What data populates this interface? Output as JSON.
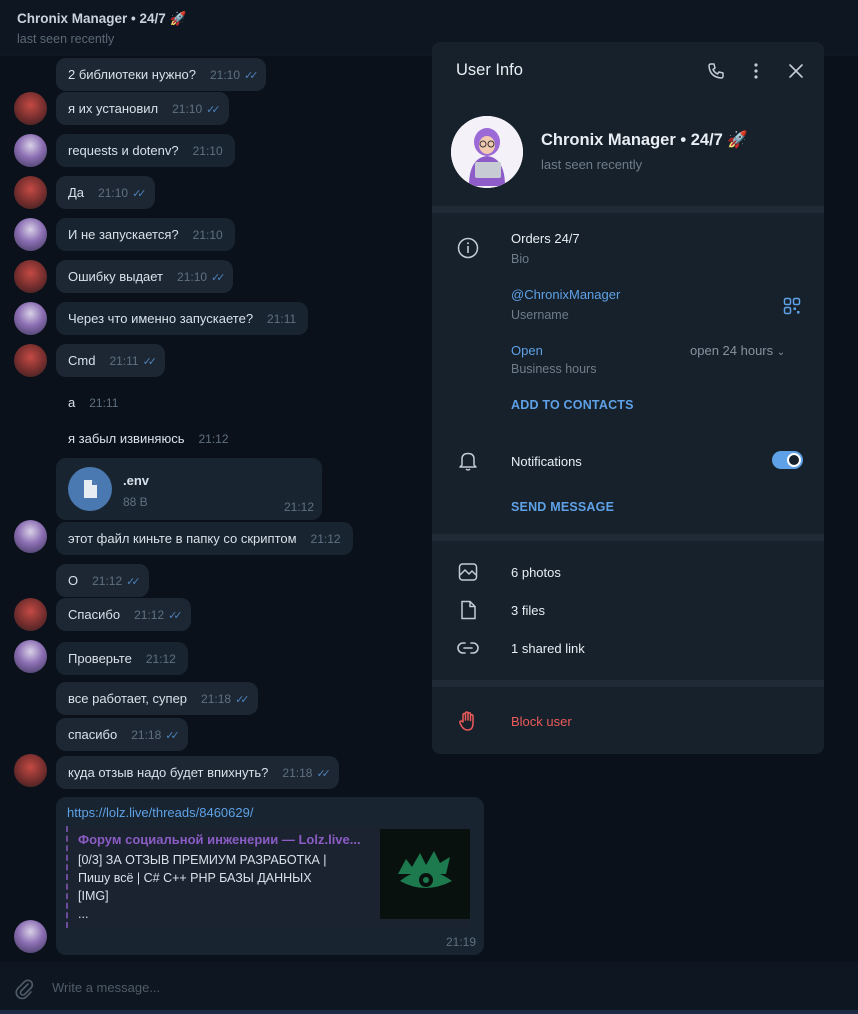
{
  "header": {
    "title": "Chronix Manager • 24/7 🚀",
    "status": "last seen recently"
  },
  "messages": [
    {
      "text": "2 библиотеки нужно?",
      "time": "21:10",
      "checks": true
    },
    {
      "text": "я их установил",
      "time": "21:10",
      "checks": true
    },
    {
      "text": "requests и dotenv?",
      "time": "21:10",
      "checks": false
    },
    {
      "text": "Да",
      "time": "21:10",
      "checks": true
    },
    {
      "text": "И не запускается?",
      "time": "21:10",
      "checks": false
    },
    {
      "text": "Ошибку выдает",
      "time": "21:10",
      "checks": true
    },
    {
      "text": "Через что именно запускаете?",
      "time": "21:11",
      "checks": false
    },
    {
      "text": "Cmd",
      "time": "21:11",
      "checks": true
    },
    {
      "text": "а",
      "time": "21:11",
      "checks": false
    },
    {
      "text": "я забыл извиняюсь",
      "time": "21:12",
      "checks": false
    },
    {
      "text": "этот файл киньте в папку со скриптом",
      "time": "21:12",
      "checks": false
    },
    {
      "text": "О",
      "time": "21:12",
      "checks": true
    },
    {
      "text": "Спасибо",
      "time": "21:12",
      "checks": true
    },
    {
      "text": "Проверьте",
      "time": "21:12",
      "checks": false
    },
    {
      "text": "все работает, супер",
      "time": "21:18",
      "checks": true
    },
    {
      "text": "спасибо",
      "time": "21:18",
      "checks": true
    },
    {
      "text": "куда отзыв надо будет впихнуть?",
      "time": "21:18",
      "checks": true
    }
  ],
  "file_message": {
    "name": ".env",
    "size": "88 B",
    "time": "21:12"
  },
  "link_message": {
    "url": "https://lolz.live/threads/8460629/",
    "site": "Форум социальной инженерии — Lolz.live...",
    "description": "[0/3] ЗА ОТЗЫВ ПРЕМИУМ РАЗРАБОТКА |\nПишу всё | C#  C++  PHP  БАЗЫ ДАННЫХ\n[IMG]\n...",
    "time": "21:19"
  },
  "composer": {
    "placeholder": "Write a message..."
  },
  "panel": {
    "title": "User Info",
    "name": "Chronix Manager • 24/7 🚀",
    "status": "last seen recently",
    "bio": "Orders 24/7",
    "bio_label": "Bio",
    "username": "@ChronixManager",
    "username_label": "Username",
    "hours_status": "Open",
    "hours_value": "open 24 hours",
    "hours_label": "Business hours",
    "add_contacts": "ADD TO CONTACTS",
    "notifications": "Notifications",
    "send_message": "SEND MESSAGE",
    "photos": "6 photos",
    "files": "3 files",
    "links": "1 shared link",
    "block": "Block user"
  },
  "colors": {
    "accent": "#5ea1e6",
    "danger": "#ec5a5a",
    "panel": "#17212b",
    "chat_bg": "#0b111a"
  }
}
